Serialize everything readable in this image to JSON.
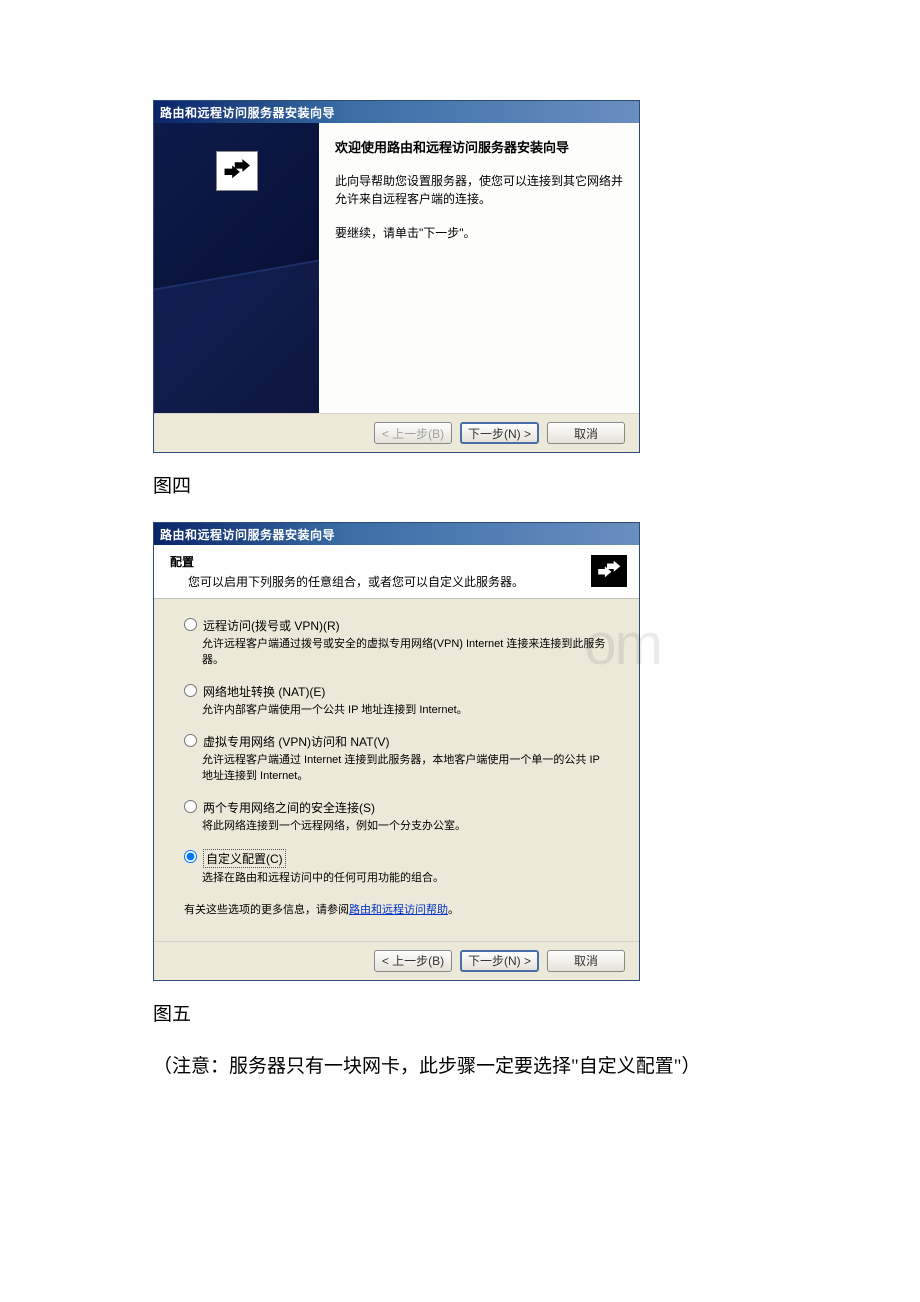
{
  "dialog1": {
    "title": "路由和远程访问服务器安装向导",
    "welcomeTitle": "欢迎使用路由和远程访问服务器安装向导",
    "welcomeDesc": "此向导帮助您设置服务器，使您可以连接到其它网络并允许来自远程客户端的连接。",
    "welcomeCont": "要继续，请单击\"下一步\"。",
    "buttons": {
      "back": "< 上一步(B)",
      "next": "下一步(N) >",
      "cancel": "取消"
    }
  },
  "dialog2": {
    "title": "路由和远程访问服务器安装向导",
    "headerTitle": "配置",
    "headerSub": "您可以启用下列服务的任意组合，或者您可以自定义此服务器。",
    "options": [
      {
        "label": "远程访问(拨号或 VPN)(R)",
        "desc": "允许远程客户端通过拨号或安全的虚拟专用网络(VPN) Internet 连接来连接到此服务器。"
      },
      {
        "label": "网络地址转换 (NAT)(E)",
        "desc": "允许内部客户端使用一个公共 IP 地址连接到 Internet。"
      },
      {
        "label": "虚拟专用网络 (VPN)访问和 NAT(V)",
        "desc": "允许远程客户端通过 Internet 连接到此服务器，本地客户端使用一个单一的公共 IP 地址连接到 Internet。"
      },
      {
        "label": "两个专用网络之间的安全连接(S)",
        "desc": "将此网络连接到一个远程网络，例如一个分支办公室。"
      },
      {
        "label": "自定义配置(C)",
        "desc": "选择在路由和远程访问中的任何可用功能的组合。"
      }
    ],
    "helpPrefix": "有关这些选项的更多信息，请参阅",
    "helpLink": "路由和远程访问帮助",
    "helpSuffix": "。",
    "buttons": {
      "back": "< 上一步(B)",
      "next": "下一步(N) >",
      "cancel": "取消"
    }
  },
  "captions": {
    "fig4": "图四",
    "fig5": "图五"
  },
  "note": "（注意：服务器只有一块网卡，此步骤一定要选择\"自定义配置\"）",
  "watermark": "om"
}
